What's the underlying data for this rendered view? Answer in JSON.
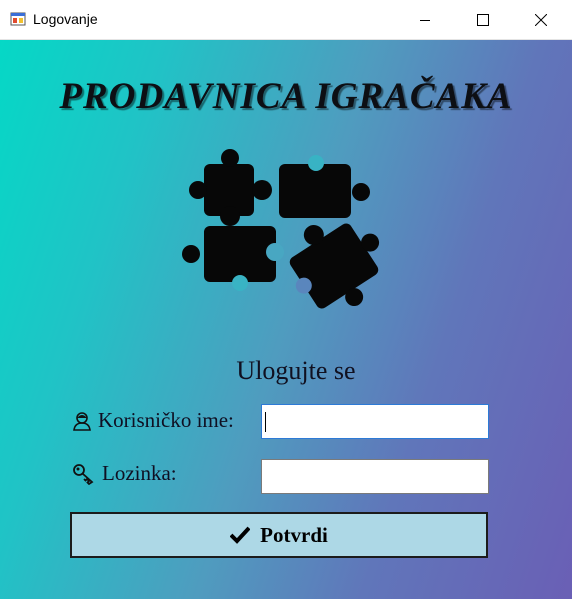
{
  "window": {
    "title": "Logovanje",
    "icon": "app-window-icon",
    "controls": [
      "minimize-icon",
      "maximize-icon",
      "close-icon"
    ]
  },
  "header": {
    "store_name": "PRODAVNICA IGRAČAKA",
    "logo": "puzzle-pieces-icon"
  },
  "form": {
    "heading": "Ulogujte se",
    "username_label": "Korisničko ime:",
    "username_icon": "user-icon",
    "username_value": "",
    "password_label": "Lozinka:",
    "password_icon": "key-icon",
    "password_value": "",
    "submit_label": "Potvrdi",
    "submit_icon": "checkmark-icon"
  },
  "colors": {
    "gradient_start": "#05d8c6",
    "gradient_end": "#6a5fb5",
    "button_bg": "#add8e6",
    "focus_border": "#2d7ad6"
  }
}
